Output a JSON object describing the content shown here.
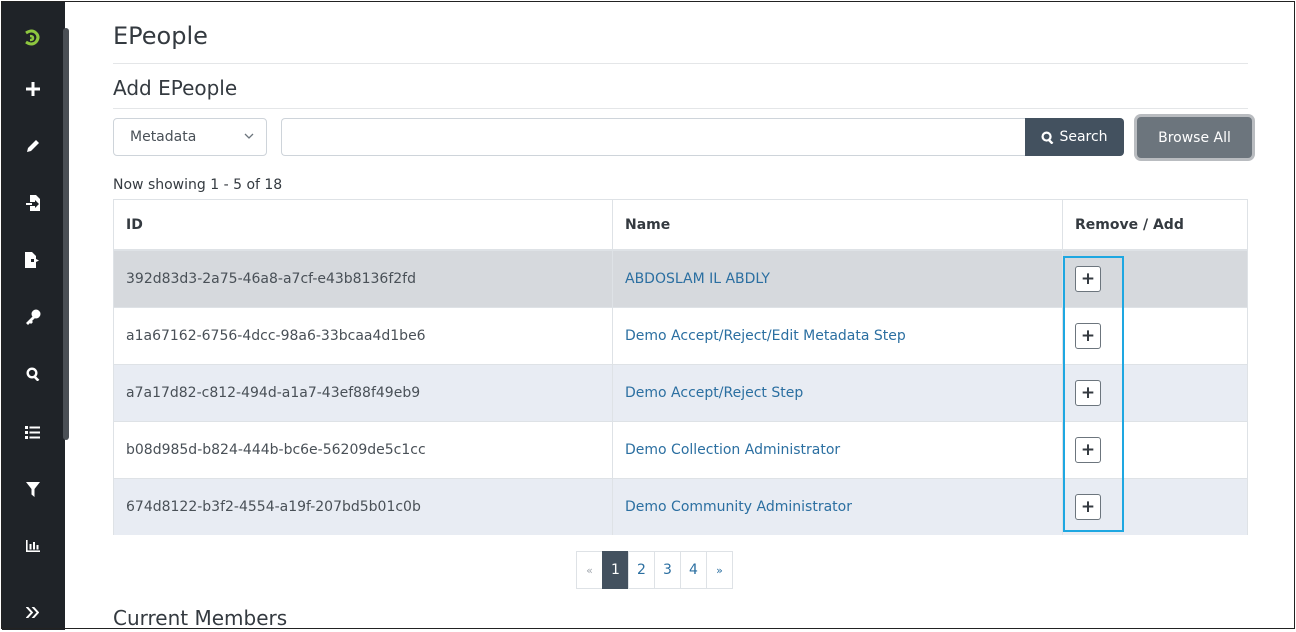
{
  "sidebar": {
    "items": [
      {
        "icon": "dspace-logo-icon"
      },
      {
        "icon": "plus-icon"
      },
      {
        "icon": "pencil-icon"
      },
      {
        "icon": "import-icon"
      },
      {
        "icon": "export-icon"
      },
      {
        "icon": "key-icon"
      },
      {
        "icon": "search-icon"
      },
      {
        "icon": "list-icon"
      },
      {
        "icon": "filter-icon"
      },
      {
        "icon": "statistics-icon"
      },
      {
        "icon": "expand-icon"
      }
    ]
  },
  "page": {
    "title": "EPeople",
    "subtitle": "Add EPeople"
  },
  "search": {
    "scope_selected": "Metadata",
    "input_value": "",
    "search_label": "Search",
    "browse_label": "Browse All"
  },
  "results": {
    "showing": "Now showing 1 - 5 of 18",
    "columns": [
      "ID",
      "Name",
      "Remove / Add"
    ],
    "rows": [
      {
        "id": "392d83d3-2a75-46a8-a7cf-e43b8136f2fd",
        "name": "ABDOSLAM IL ABDLY",
        "action": "+"
      },
      {
        "id": "a1a67162-6756-4dcc-98a6-33bcaa4d1be6",
        "name": "Demo Accept/Reject/Edit Metadata Step",
        "action": "+"
      },
      {
        "id": "a7a17d82-c812-494d-a1a7-43ef88f49eb9",
        "name": "Demo Accept/Reject Step",
        "action": "+"
      },
      {
        "id": "b08d985d-b824-444b-bc6e-56209de5c1cc",
        "name": "Demo Collection Administrator",
        "action": "+"
      },
      {
        "id": "674d8122-b3f2-4554-a19f-207bd5b01c0b",
        "name": "Demo Community Administrator",
        "action": "+"
      }
    ]
  },
  "pagination": {
    "prev": "«",
    "pages": [
      "1",
      "2",
      "3",
      "4"
    ],
    "active": "1",
    "next": "»"
  },
  "members": {
    "heading": "Current Members"
  },
  "colors": {
    "sidebar_bg": "#1f2328",
    "primary": "#43515f",
    "secondary": "#6c757d",
    "link": "#2b6fa1",
    "highlight": "#1ea7e1"
  }
}
